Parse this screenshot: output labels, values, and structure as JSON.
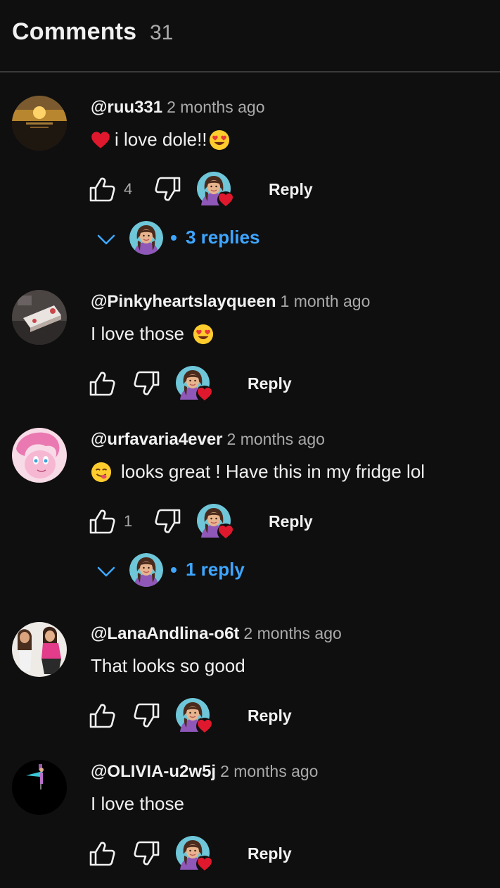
{
  "header": {
    "title": "Comments",
    "count": "31"
  },
  "colors": {
    "background": "#0f0f0f",
    "link": "#3ea6ff",
    "heart": "#e0182d",
    "muted": "#aaaaaa"
  },
  "comments": [
    {
      "handle": "@ruu331",
      "time": "2 months ago",
      "text": "i love dole!!",
      "likes": "4",
      "reply_label": "Reply",
      "replies_label": "3 replies",
      "avatar": "sunset-avatar"
    },
    {
      "handle": "@Pinkyheartslayqueen",
      "time": "1 month ago",
      "text": "I love those",
      "likes": "",
      "reply_label": "Reply",
      "avatar": "cake-avatar"
    },
    {
      "handle": "@urfavaria4ever",
      "time": "2 months ago",
      "text": "looks great ! Have this in my fridge lol",
      "likes": "1",
      "reply_label": "Reply",
      "replies_label": "1 reply",
      "avatar": "pink-pony-avatar"
    },
    {
      "handle": "@LanaAndlina-o6t",
      "time": "2 months ago",
      "text": "That looks so good",
      "likes": "",
      "reply_label": "Reply",
      "avatar": "dolls-avatar"
    },
    {
      "handle": "@OLIVIA-u2w5j",
      "time": "2 months ago",
      "text": "I love those",
      "likes": "",
      "reply_label": "Reply",
      "avatar": "dark-avatar"
    }
  ]
}
